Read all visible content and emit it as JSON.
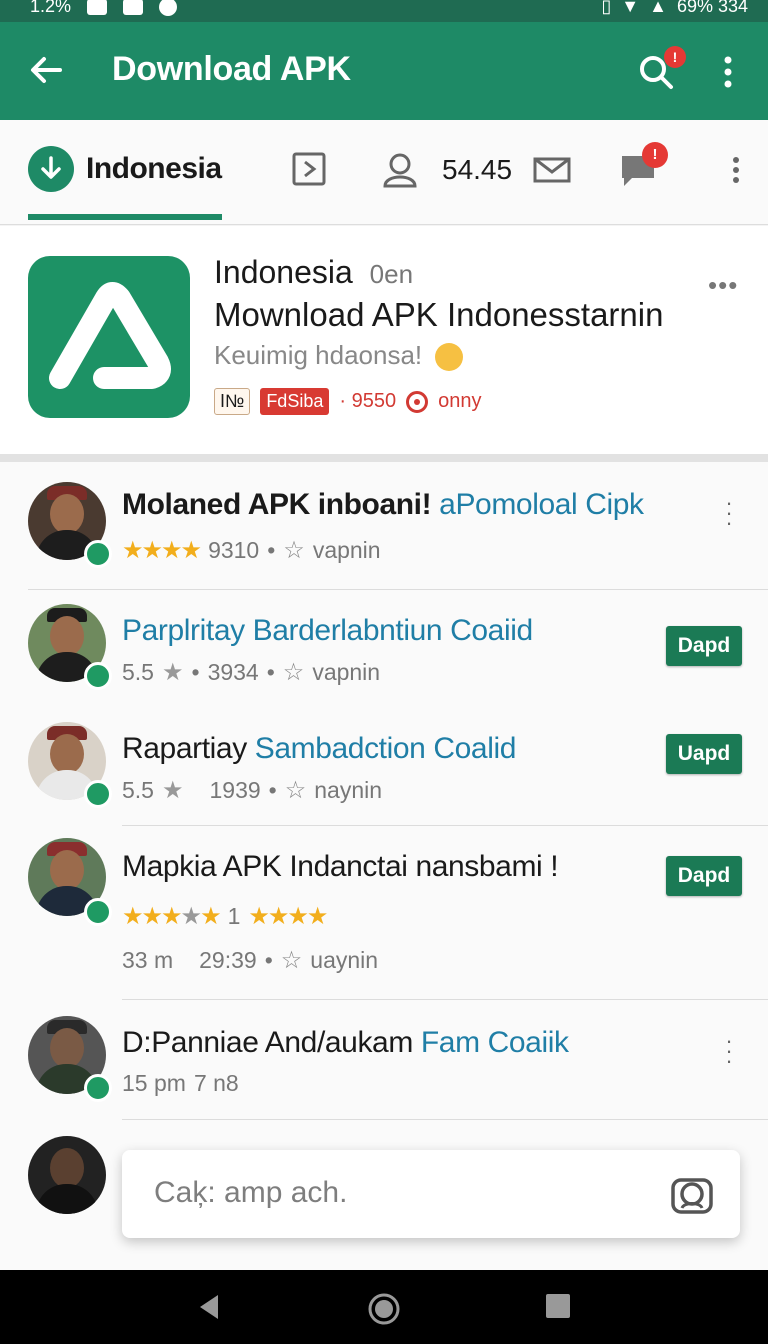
{
  "status_bar": {
    "left_text": "1.2%",
    "right_text": "69% 334",
    "icons": [
      "mail-icon",
      "image-icon",
      "emoji-icon",
      "vibrate-icon",
      "wifi-icon",
      "signal-icon",
      "battery-icon"
    ]
  },
  "app_bar": {
    "title": "Download APK",
    "search_badge": "!",
    "icons": [
      "back-arrow-icon",
      "search-icon",
      "more-vert-icon"
    ]
  },
  "tab_bar": {
    "home_label": "Indonesia",
    "count": "54.45",
    "chat_badge": "!",
    "icons": [
      "download-icon",
      "flag-icon",
      "user-icon",
      "mail-icon",
      "chat-icon",
      "more-vert-icon"
    ]
  },
  "app_header": {
    "title": "Indonesia",
    "title_suffix": "0en",
    "app_name": "Mownload APK Indonesstarnin",
    "tagline": "Keuimig hdaonsa!",
    "badges": [
      "I№",
      "FdSiba"
    ],
    "meta_value": "9550",
    "meta_label": "onny",
    "more_label": "•••"
  },
  "list_items": [
    {
      "title": "Molaned APK inboani!",
      "title_link": "aPomoloal Cipk",
      "rating_text": "9310",
      "rating_stars": 3.5,
      "meta_action": "vapnin",
      "has_button": false
    },
    {
      "title": "",
      "title_link": "Parplritay Barderlabntiun Coaiid",
      "rating_text": "5.5",
      "secondary_text": "3934",
      "meta_action": "vapnin",
      "button_label": "Dapd",
      "has_button": true
    },
    {
      "title": "Rapartiay",
      "title_link": "Sambadction Coalid",
      "rating_text": "5.5",
      "secondary_text": "1939",
      "meta_action": "naynin",
      "button_label": "Uapd",
      "has_button": true
    },
    {
      "title": "Mapkia APK Indanctai nansbami !",
      "title_link": "",
      "rating_text": "1",
      "rating_stars": 3,
      "time_text": "33 m",
      "secondary_text": "29:39",
      "meta_action": "uaynin",
      "button_label": "Dapd",
      "has_button": true
    },
    {
      "title": "D:Panniae And/aukam",
      "title_link": "Fam Coaiik",
      "time_text": "15 pm",
      "secondary_text": "7 n8",
      "has_button": false
    }
  ],
  "search": {
    "placeholder": "Caķ: amp ach."
  },
  "nav_bar": {
    "icons": [
      "back-triangle-icon",
      "home-circle-icon",
      "recents-square-icon"
    ]
  },
  "colors": {
    "primary": "#1e8a66",
    "status_bar": "#1f6b52",
    "button": "#1b7a55",
    "link": "#1f7ea6",
    "badge_red": "#e53935",
    "star": "#f2ae1c"
  }
}
